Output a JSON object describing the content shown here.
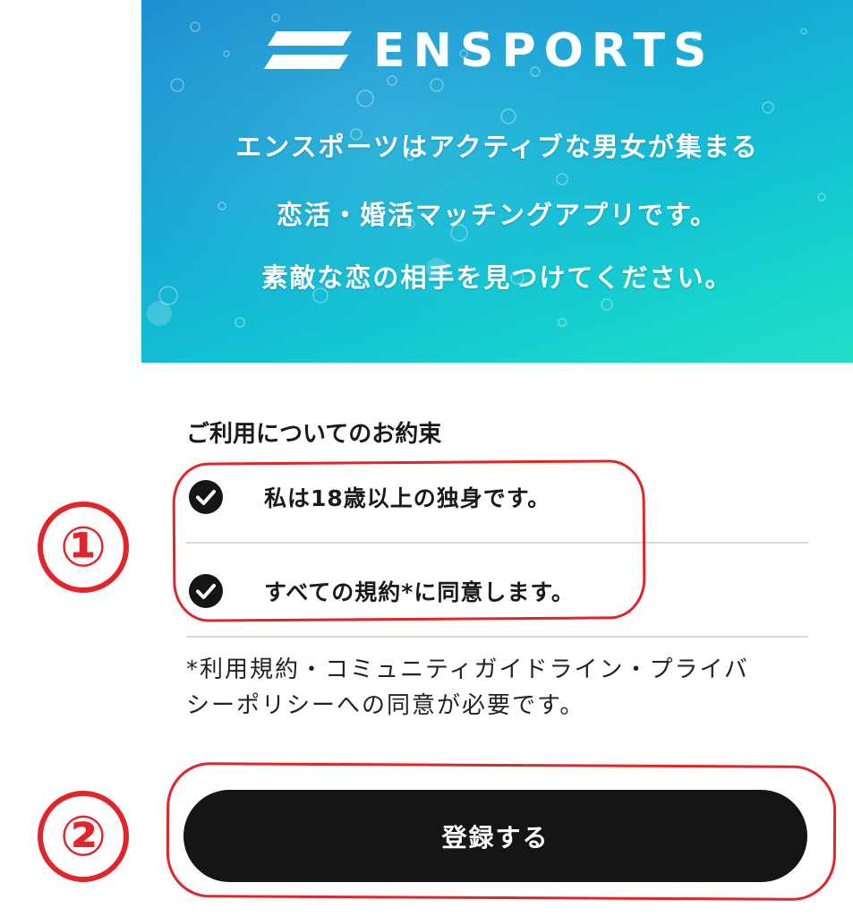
{
  "hero": {
    "brand_name": "ENSPORTS",
    "tagline": [
      "エンスポーツはアクティブな男女が集まる",
      "恋活・婚活マッチングアプリです。",
      "素敵な恋の相手を見つけてください。"
    ],
    "gradient_colors": [
      "#1f8fcf",
      "#13bfd4",
      "#24ddc8"
    ]
  },
  "agreement": {
    "title": "ご利用についてのお約束",
    "items": [
      {
        "label": "私は18歳以上の独身です。",
        "checked": true,
        "icon": "check-circle-icon"
      },
      {
        "label": "すべての規約*に同意します。",
        "checked": true,
        "icon": "check-circle-icon"
      }
    ],
    "note_lines": [
      "*利用規約・コミュニティガイドライン・プライバ",
      "シーポリシーへの同意が必要です。"
    ]
  },
  "register_button": {
    "label": "登録する",
    "color": "#151515"
  },
  "annotations": {
    "color": "#e0262b",
    "markers": [
      "①",
      "②"
    ]
  }
}
